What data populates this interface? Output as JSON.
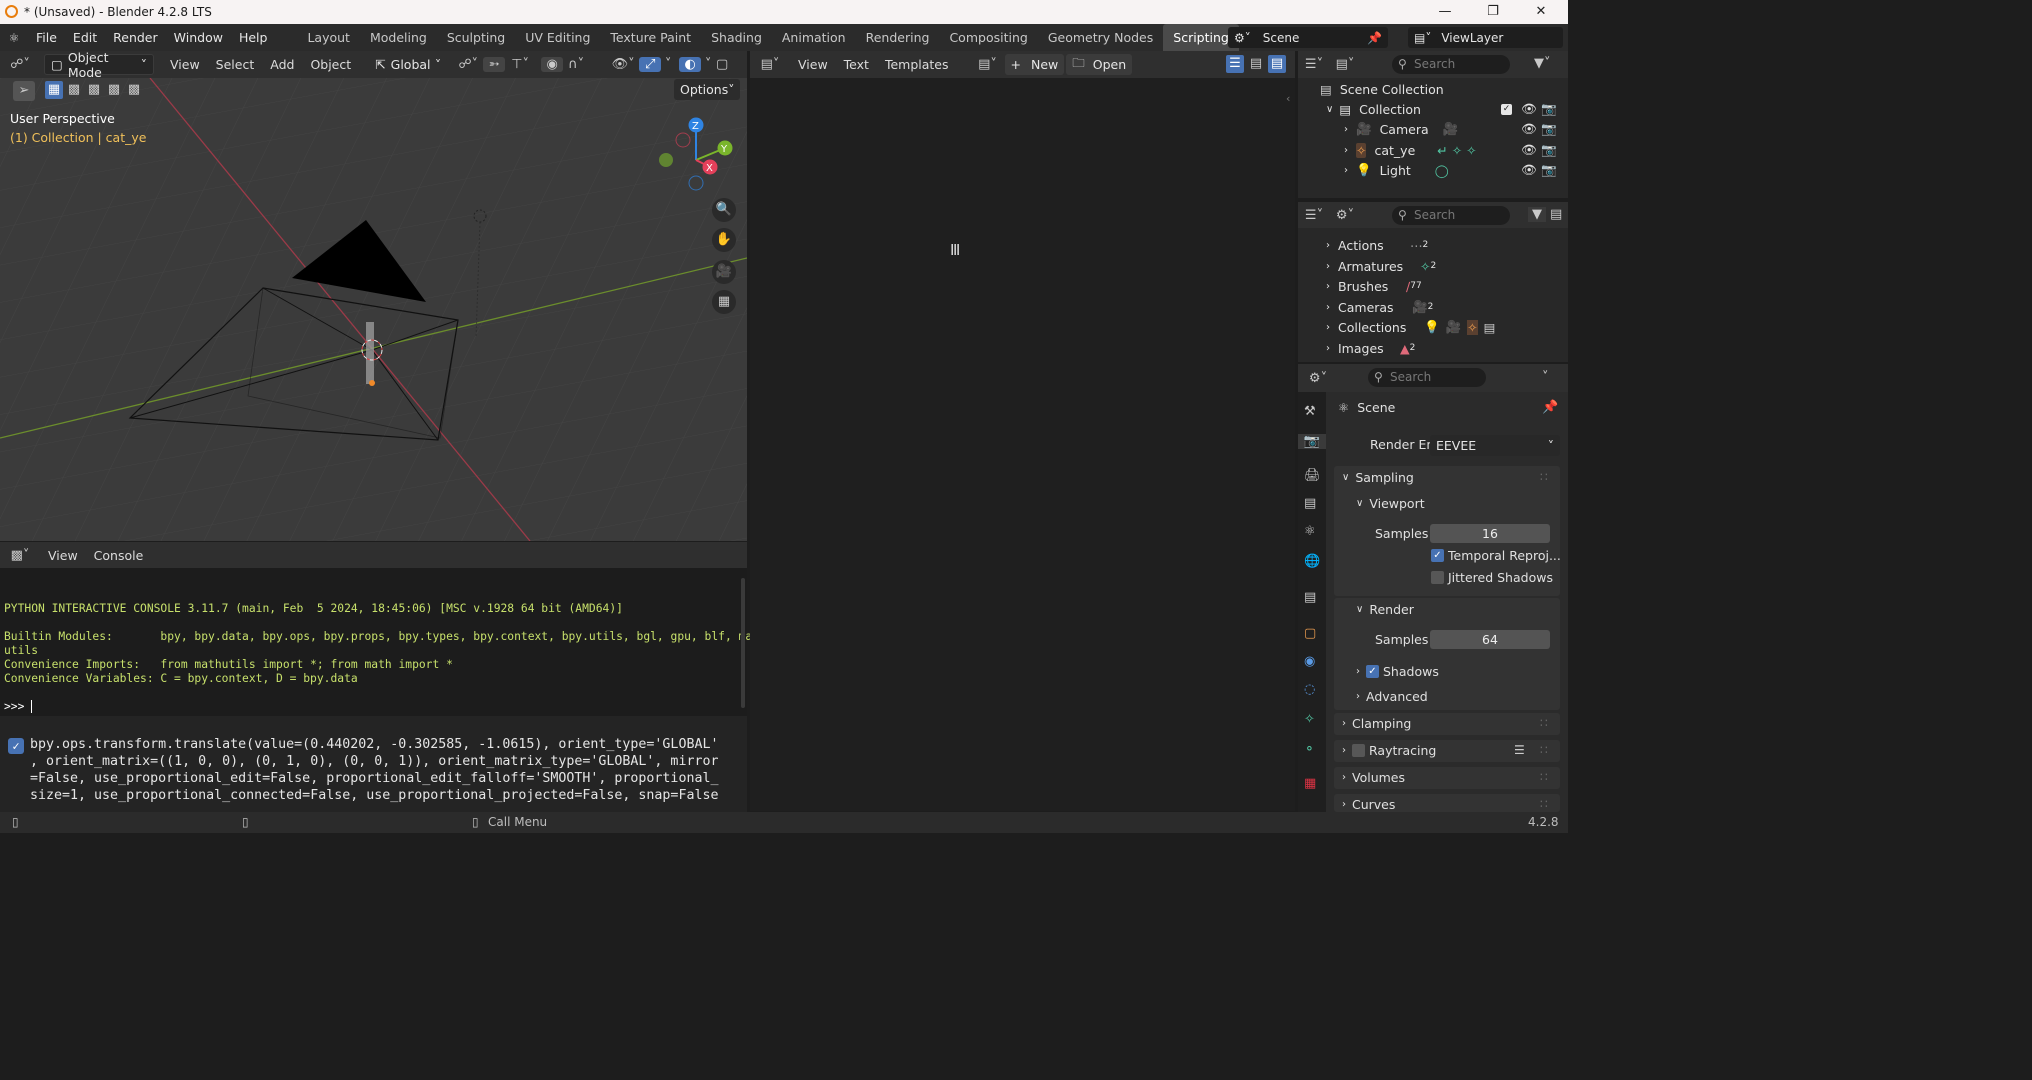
{
  "window": {
    "title": "* (Unsaved) - Blender 4.2.8 LTS"
  },
  "menu": [
    "File",
    "Edit",
    "Render",
    "Window",
    "Help"
  ],
  "workspaces": [
    "Layout",
    "Modeling",
    "Sculpting",
    "UV Editing",
    "Texture Paint",
    "Shading",
    "Animation",
    "Rendering",
    "Compositing",
    "Geometry Nodes",
    "Scripting"
  ],
  "active_workspace": "Scripting",
  "scene": {
    "name": "Scene",
    "view_layer": "ViewLayer"
  },
  "viewport": {
    "mode": "Object Mode",
    "menus": [
      "View",
      "Select",
      "Add",
      "Object"
    ],
    "orientation": "Global",
    "options_label": "Options",
    "perspective": "User Perspective",
    "context": "(1) Collection | cat_ye",
    "gizmo_axes": [
      "Z",
      "Y",
      "X"
    ]
  },
  "text_editor": {
    "menus": [
      "View",
      "Text",
      "Templates"
    ],
    "new_label": "New",
    "open_label": "Open"
  },
  "console": {
    "menus": [
      "View",
      "Console"
    ],
    "lines": [
      "PYTHON INTERACTIVE CONSOLE 3.11.7 (main, Feb  5 2024, 18:45:06) [MSC v.1928 64 bit (AMD64)]",
      "",
      "Builtin Modules:       bpy, bpy.data, bpy.ops, bpy.props, bpy.types, bpy.context, bpy.utils, bgl, gpu, blf, math",
      "utils",
      "Convenience Imports:   from mathutils import *; from math import *",
      "Convenience Variables: C = bpy.context, D = bpy.data"
    ],
    "prompt": ">>> "
  },
  "info": {
    "lines": [
      "bpy.ops.transform.translate(value=(0.440202, -0.302585, -1.0615), orient_type='GLOBAL'",
      ", orient_matrix=((1, 0, 0), (0, 1, 0), (0, 0, 1)), orient_matrix_type='GLOBAL', mirror",
      "=False, use_proportional_edit=False, proportional_edit_falloff='SMOOTH', proportional_",
      "size=1, use_proportional_connected=False, use_proportional_projected=False, snap=False"
    ]
  },
  "outliner": {
    "search_placeholder": "Search",
    "root": "Scene Collection",
    "collection": "Collection",
    "items": [
      "Camera",
      "cat_ye",
      "Light"
    ]
  },
  "data_api": {
    "search_placeholder": "Search",
    "items": [
      {
        "label": "Actions",
        "count": "2"
      },
      {
        "label": "Armatures",
        "count": "2"
      },
      {
        "label": "Brushes",
        "count": "77"
      },
      {
        "label": "Cameras",
        "count": "2"
      },
      {
        "label": "Collections",
        "count": ""
      },
      {
        "label": "Images",
        "count": "2"
      }
    ]
  },
  "properties": {
    "search_placeholder": "Search",
    "context": "Scene",
    "render_engine_label": "Render Engine",
    "render_engine": "EEVEE",
    "sampling": "Sampling",
    "viewport": "Viewport",
    "samples_label": "Samples",
    "viewport_samples": "16",
    "temporal_reprojection": "Temporal Reproj...",
    "jittered_shadows": "Jittered Shadows",
    "render": "Render",
    "render_samples": "64",
    "shadows": "Shadows",
    "advanced": "Advanced",
    "clamping": "Clamping",
    "raytracing": "Raytracing",
    "volumes": "Volumes",
    "curves": "Curves"
  },
  "statusbar": {
    "call_menu": "Call Menu",
    "version": "4.2.8"
  },
  "colors": {
    "accent": "#4772b3",
    "x_axis": "#e4405a",
    "y_axis": "#7ab52b",
    "z_axis": "#2f84e3"
  }
}
